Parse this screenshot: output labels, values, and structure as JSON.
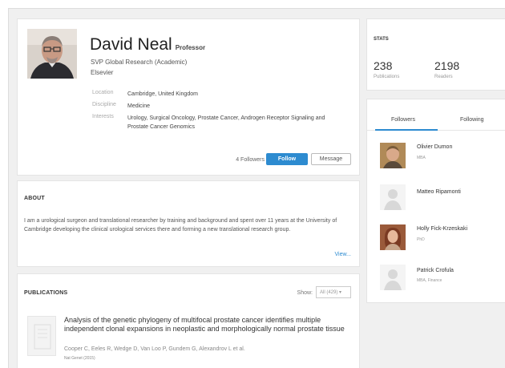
{
  "profile": {
    "name": "David Neal",
    "title_tag": "Professor",
    "position": "SVP Global Research (Academic)",
    "organization": "Elsevier",
    "details": [
      {
        "label": "Location",
        "value": "Cambridge, United Kingdom"
      },
      {
        "label": "Discipline",
        "value": "Medicine"
      },
      {
        "label": "Interests",
        "value": "Urology, Surgical Oncology, Prostate Cancer, Androgen Receptor Signaling and Prostate Cancer Genomics"
      }
    ],
    "followers_count": "4 Followers",
    "follow_label": "Follow",
    "message_label": "Message"
  },
  "about": {
    "title": "ABOUT",
    "text": "I am a urological surgeon and translational researcher by training and background and spent over 11 years at the University of Cambridge developing the clinical urological services there and forming a new translational research group.",
    "more_label": "View..."
  },
  "publications": {
    "title": "PUBLICATIONS",
    "show_label": "Show:",
    "show_value": "All (429)",
    "items": [
      {
        "title": "Analysis of the genetic phylogeny of multifocal prostate cancer identifies multiple independent clonal expansions in neoplastic and morphologically normal prostate tissue",
        "authors": "Cooper C, Eeles R, Wedge D, Van Loo P, Gundem G, Alexandrov L et al.",
        "journal": "Nat Genet (2015)"
      }
    ]
  },
  "stats": {
    "title": "STATS",
    "publications_value": "238",
    "publications_label": "Publications",
    "readers_value": "2198",
    "readers_label": "Readers"
  },
  "follow_panel": {
    "tabs": [
      "Followers",
      "Following"
    ],
    "people": [
      {
        "name": "Olivier Dumon",
        "sub": "MBA"
      },
      {
        "name": "Matteo Ripamonti",
        "sub": ""
      },
      {
        "name": "Holly Fick-Krzeskaki",
        "sub": "PhD"
      },
      {
        "name": "Patrick Crofula",
        "sub": "MBA, Finance"
      }
    ]
  },
  "colors": {
    "accent": "#2d8bd0",
    "background": "#f0f0f0"
  }
}
